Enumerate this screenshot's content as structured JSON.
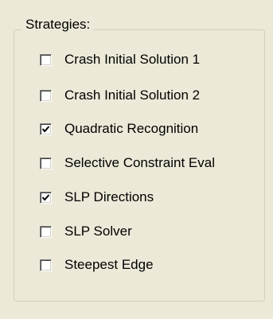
{
  "strategies": {
    "title": "Strategies:",
    "options": [
      {
        "label": "Crash Initial Solution 1",
        "checked": false
      },
      {
        "label": "Crash Initial Solution 2",
        "checked": false
      },
      {
        "label": "Quadratic Recognition",
        "checked": true
      },
      {
        "label": "Selective Constraint Eval",
        "checked": false
      },
      {
        "label": "SLP Directions",
        "checked": true
      },
      {
        "label": "SLP Solver",
        "checked": false
      },
      {
        "label": "Steepest Edge",
        "checked": false
      }
    ]
  }
}
